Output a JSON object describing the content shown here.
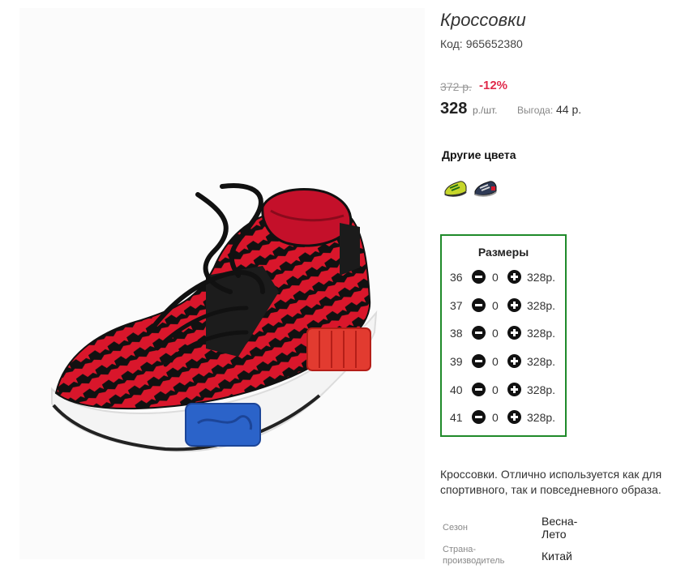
{
  "product": {
    "title": "Кроссовки",
    "code_label": "Код:",
    "code_value": "965652380"
  },
  "pricing": {
    "old_price": "372 р.",
    "discount": "-12%",
    "price": "328",
    "price_unit": "р./шт.",
    "benefit_label": "Выгода:",
    "benefit_value": "44 р."
  },
  "colors": {
    "heading": "Другие цвета",
    "swatches": [
      "green-sneaker-icon",
      "navy-sneaker-icon"
    ]
  },
  "sizes": {
    "heading": "Размеры",
    "rows": [
      {
        "size": "36",
        "qty": "0",
        "price": "328р."
      },
      {
        "size": "37",
        "qty": "0",
        "price": "328р."
      },
      {
        "size": "38",
        "qty": "0",
        "price": "328р."
      },
      {
        "size": "39",
        "qty": "0",
        "price": "328р."
      },
      {
        "size": "40",
        "qty": "0",
        "price": "328р."
      },
      {
        "size": "41",
        "qty": "0",
        "price": "328р."
      }
    ]
  },
  "description": "Кроссовки. Отлично используется как для спортивного, так и повседневного образа.",
  "attributes": {
    "season_label": "Сезон",
    "season_value": "Весна-Лето",
    "country_label": "Страна-производитель",
    "country_value": "Китай"
  },
  "theme": {
    "accent_green": "#1f8a2a",
    "discount_red": "#e0294a",
    "shoe_red": "#d9162b"
  },
  "image": {
    "icon": "red-sneaker-photo"
  }
}
